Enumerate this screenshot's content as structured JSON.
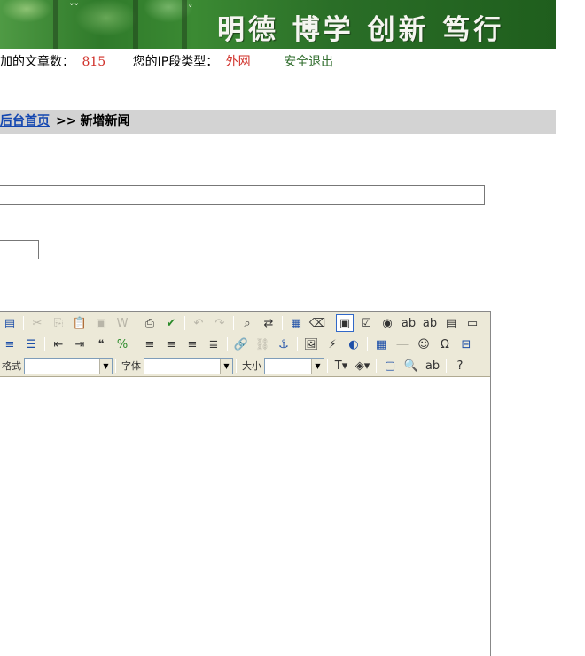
{
  "banner": {
    "motto": "明德 博学 创新 笃行"
  },
  "info": {
    "articles_label": "加的文章数：",
    "articles_count": "815",
    "ip_label": "您的IP段类型：",
    "ip_type": "外网",
    "logout": "安全退出"
  },
  "breadcrumb": {
    "home": "后台首页",
    "separator": ">>",
    "current": "新增新闻"
  },
  "form": {
    "title_value": "",
    "small_value": ""
  },
  "editor": {
    "toolbar_row1": [
      {
        "name": "source-code-icon",
        "glyph": "▤",
        "style": "blue"
      },
      {
        "name": "cut-icon",
        "glyph": "✂",
        "style": "dis"
      },
      {
        "name": "copy-icon",
        "glyph": "⎘",
        "style": "dis"
      },
      {
        "name": "paste-icon",
        "glyph": "📋",
        "style": "dis"
      },
      {
        "name": "paste-text-icon",
        "glyph": "▣",
        "style": "dis"
      },
      {
        "name": "paste-word-icon",
        "glyph": "W",
        "style": "dis"
      },
      {
        "name": "print-icon",
        "glyph": "⎙",
        "style": ""
      },
      {
        "name": "spellcheck-icon",
        "glyph": "✔",
        "style": "green"
      },
      {
        "name": "undo-icon",
        "glyph": "↶",
        "style": "dis"
      },
      {
        "name": "redo-icon",
        "glyph": "↷",
        "style": "dis"
      },
      {
        "name": "find-icon",
        "glyph": "⌕",
        "style": ""
      },
      {
        "name": "replace-icon",
        "glyph": "⇄",
        "style": ""
      },
      {
        "name": "select-all-icon",
        "glyph": "▦",
        "style": "blue"
      },
      {
        "name": "remove-format-icon",
        "glyph": "⌫",
        "style": ""
      },
      {
        "name": "form-icon",
        "glyph": "▣",
        "style": "active"
      },
      {
        "name": "checkbox-icon",
        "glyph": "☑",
        "style": ""
      },
      {
        "name": "radio-icon",
        "glyph": "◉",
        "style": ""
      },
      {
        "name": "text-field-icon",
        "glyph": "ab",
        "style": ""
      },
      {
        "name": "textarea-icon",
        "glyph": "ab",
        "style": ""
      },
      {
        "name": "select-field-icon",
        "glyph": "▤",
        "style": ""
      },
      {
        "name": "button-field-icon",
        "glyph": "▭",
        "style": ""
      }
    ],
    "toolbar_row2": [
      {
        "name": "ordered-list-icon",
        "glyph": "≡",
        "style": "blue"
      },
      {
        "name": "unordered-list-icon",
        "glyph": "☰",
        "style": "blue"
      },
      {
        "name": "outdent-icon",
        "glyph": "⇤",
        "style": ""
      },
      {
        "name": "indent-icon",
        "glyph": "⇥",
        "style": ""
      },
      {
        "name": "blockquote-icon",
        "glyph": "❝",
        "style": ""
      },
      {
        "name": "div-icon",
        "glyph": "%",
        "style": "green"
      },
      {
        "name": "align-left-icon",
        "glyph": "≡",
        "style": ""
      },
      {
        "name": "align-center-icon",
        "glyph": "≡",
        "style": ""
      },
      {
        "name": "align-right-icon",
        "glyph": "≡",
        "style": ""
      },
      {
        "name": "justify-icon",
        "glyph": "≣",
        "style": ""
      },
      {
        "name": "link-icon",
        "glyph": "🔗",
        "style": "blue"
      },
      {
        "name": "unlink-icon",
        "glyph": "⛓",
        "style": "dis"
      },
      {
        "name": "anchor-icon",
        "glyph": "⚓",
        "style": "blue"
      },
      {
        "name": "image-icon",
        "glyph": "🖼",
        "style": ""
      },
      {
        "name": "flash-icon",
        "glyph": "⚡",
        "style": ""
      },
      {
        "name": "media-icon",
        "glyph": "◐",
        "style": "blue"
      },
      {
        "name": "table-icon",
        "glyph": "▦",
        "style": "blue"
      },
      {
        "name": "horizontal-rule-icon",
        "glyph": "―",
        "style": "dis"
      },
      {
        "name": "smiley-icon",
        "glyph": "☺",
        "style": ""
      },
      {
        "name": "special-char-icon",
        "glyph": "Ω",
        "style": ""
      },
      {
        "name": "page-break-icon",
        "glyph": "⊟",
        "style": "blue"
      }
    ],
    "toolbar_row3": {
      "format_label": "格式",
      "font_label": "字体",
      "size_label": "大小",
      "format_value": "",
      "font_value": "",
      "size_value": "",
      "buttons": [
        {
          "name": "text-color-icon",
          "glyph": "T▾",
          "style": ""
        },
        {
          "name": "background-color-icon",
          "glyph": "◈▾",
          "style": ""
        },
        {
          "name": "maximize-icon",
          "glyph": "▢",
          "style": "blue"
        },
        {
          "name": "preview-icon",
          "glyph": "🔍",
          "style": ""
        },
        {
          "name": "show-blocks-icon",
          "glyph": "ab",
          "style": ""
        },
        {
          "name": "about-icon",
          "glyph": "?",
          "style": ""
        }
      ]
    }
  }
}
